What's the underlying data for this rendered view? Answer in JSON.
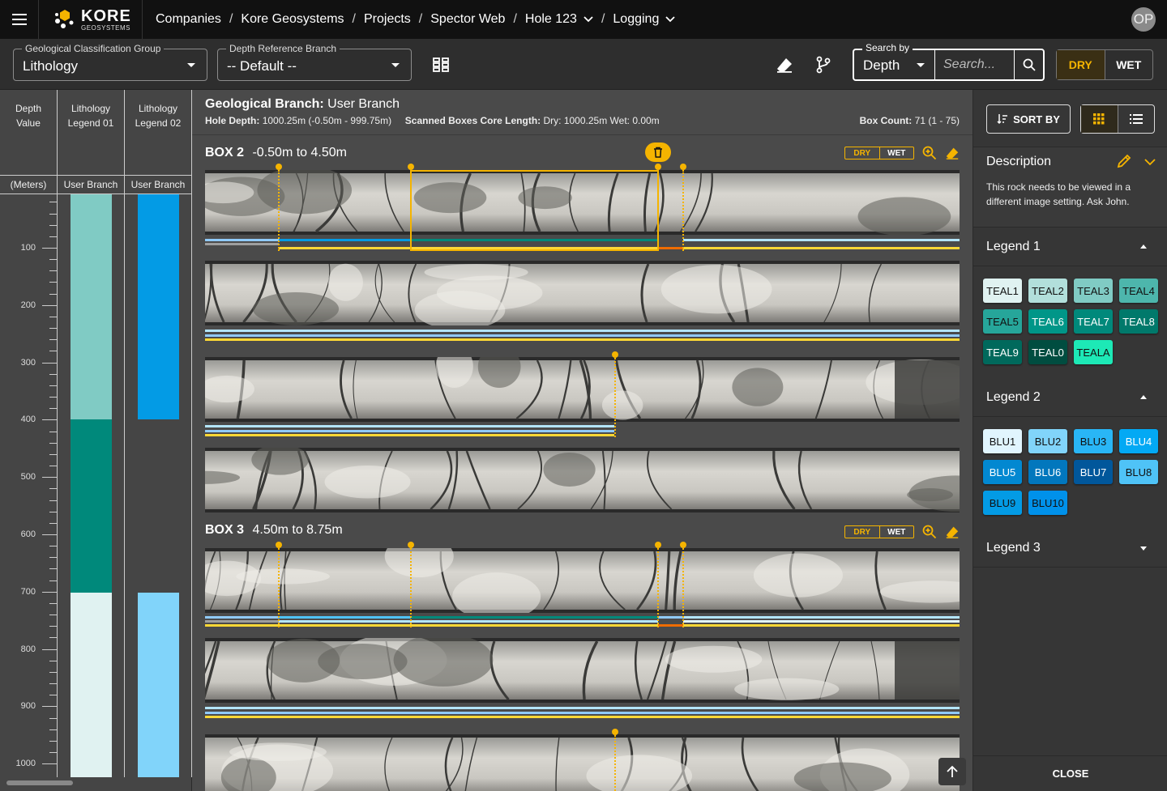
{
  "topbar": {
    "brand": "KORE",
    "brand_sub": "GEOSYSTEMS",
    "breadcrumbs": [
      "Companies",
      "Kore Geosystems",
      "Projects",
      "Spector Web",
      "Hole 123",
      "Logging"
    ],
    "separator": "/",
    "avatar_initials": "OP"
  },
  "toolbar": {
    "classification_label": "Geological Classification Group",
    "classification_value": "Lithology",
    "branch_label": "Depth Reference Branch",
    "branch_value": "-- Default --",
    "search_by_label": "Search by",
    "search_by_value": "Depth",
    "search_placeholder": "Search...",
    "dry_label": "DRY",
    "wet_label": "WET"
  },
  "leftcol": {
    "headers": [
      {
        "l1": "Depth",
        "l2": "Value"
      },
      {
        "l1": "Lithology",
        "l2": "Legend 01"
      },
      {
        "l1": "Lithology",
        "l2": "Legend 02"
      }
    ],
    "subheaders": [
      "(Meters)",
      "User Branch",
      "User Branch"
    ],
    "depth_labels": [
      "100",
      "200",
      "300",
      "400",
      "500",
      "600",
      "700",
      "800",
      "900",
      "1000"
    ],
    "legend01_colors": [
      "#80cbc4",
      "#00897b",
      "#e0f2f1"
    ],
    "legend02_colors": [
      "#039be5",
      "#81d4fa"
    ]
  },
  "main": {
    "branch_label": "Geological Branch:",
    "branch_value": "User Branch",
    "hole_depth_label": "Hole Depth:",
    "hole_depth_value": "1000.25m (-0.50m - 999.75m)",
    "scanned_label": "Scanned Boxes Core Length:",
    "scanned_value": "Dry: 1000.25m Wet: 0.00m",
    "box_count_label": "Box Count:",
    "box_count_value": "71 (1 - 75)",
    "boxes": [
      {
        "name": "BOX 2",
        "range": "-0.50m to 4.50m",
        "dry": "DRY",
        "wet": "WET"
      },
      {
        "name": "BOX 3",
        "range": "4.50m to 8.75m",
        "dry": "DRY",
        "wet": "WET"
      }
    ]
  },
  "right": {
    "sort_label": "SORT BY",
    "description_title": "Description",
    "description_text": "This rock needs to be viewed in a different image setting. Ask John.",
    "legend1_title": "Legend 1",
    "legend1_chips": [
      {
        "label": "TEAL1",
        "bg": "#e0f2f1",
        "fg": "#111"
      },
      {
        "label": "TEAL2",
        "bg": "#b2dfdb",
        "fg": "#111"
      },
      {
        "label": "TEAL3",
        "bg": "#80cbc4",
        "fg": "#111"
      },
      {
        "label": "TEAL4",
        "bg": "#4db6ac",
        "fg": "#111"
      },
      {
        "label": "TEAL5",
        "bg": "#26a69a",
        "fg": "#111"
      },
      {
        "label": "TEAL6",
        "bg": "#009688",
        "fg": "#fff"
      },
      {
        "label": "TEAL7",
        "bg": "#00897b",
        "fg": "#fff"
      },
      {
        "label": "TEAL8",
        "bg": "#00796b",
        "fg": "#fff"
      },
      {
        "label": "TEAL9",
        "bg": "#00695c",
        "fg": "#fff"
      },
      {
        "label": "TEAL0",
        "bg": "#004d40",
        "fg": "#fff"
      },
      {
        "label": "TEALA",
        "bg": "#1de9b6",
        "fg": "#111"
      }
    ],
    "legend2_title": "Legend 2",
    "legend2_chips": [
      {
        "label": "BLU1",
        "bg": "#e1f5fe",
        "fg": "#111"
      },
      {
        "label": "BLU2",
        "bg": "#81d4fa",
        "fg": "#111"
      },
      {
        "label": "BLU3",
        "bg": "#29b6f6",
        "fg": "#111"
      },
      {
        "label": "BLU4",
        "bg": "#03a9f4",
        "fg": "#fff"
      },
      {
        "label": "BLU5",
        "bg": "#0288d1",
        "fg": "#fff"
      },
      {
        "label": "BLU6",
        "bg": "#0277bd",
        "fg": "#fff"
      },
      {
        "label": "BLU7",
        "bg": "#01579b",
        "fg": "#fff"
      },
      {
        "label": "BLU8",
        "bg": "#4fc3f7",
        "fg": "#111"
      },
      {
        "label": "BLU9",
        "bg": "#039be5",
        "fg": "#111"
      },
      {
        "label": "BLU10",
        "bg": "#0091ea",
        "fg": "#111"
      }
    ],
    "legend3_title": "Legend 3",
    "close_label": "CLOSE"
  },
  "colors": {
    "accent": "#f5b400",
    "topbar": "#111111",
    "panel": "#363636"
  }
}
